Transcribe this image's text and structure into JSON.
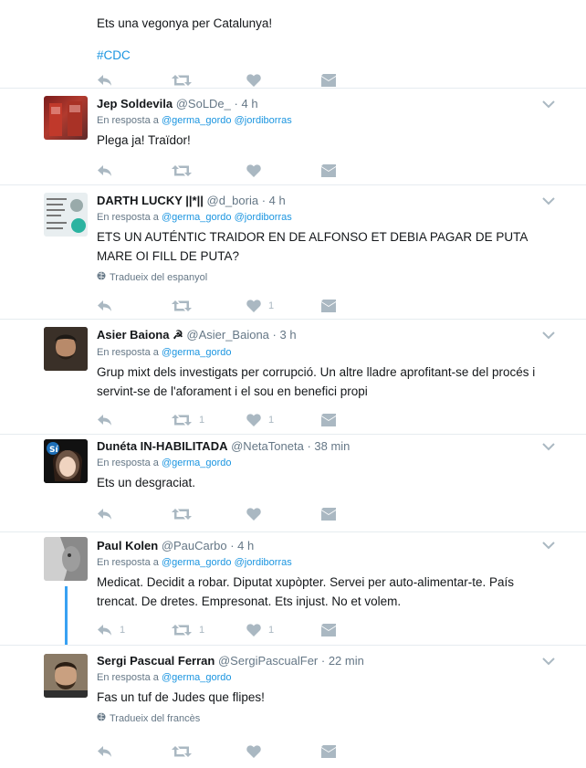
{
  "top_tweet": {
    "lines": [
      "Ets una vegonya per Catalunya!"
    ],
    "hashtag": "#CDC"
  },
  "tweets": [
    {
      "name": "Jep Soldevila",
      "handle": "@SoLDe_",
      "time": "· 4 h",
      "reply_prefix": "En resposta a",
      "reply_to": "@germa_gordo @jordiborras",
      "text": [
        "Plega ja! Traïdor!"
      ],
      "translate": "",
      "reply_count": "",
      "retweet_count": "",
      "like_count": ""
    },
    {
      "name": "DARTH LUCKY ||*||",
      "handle": "@d_boria",
      "time": "· 4 h",
      "reply_prefix": "En resposta a",
      "reply_to": "@germa_gordo @jordiborras",
      "text": [
        "ETS UN AUTÉNTIC TRAIDOR EN DE ALFONSO ET DEBIA PAGAR DE PUTA",
        "MARE OI FILL DE PUTA?"
      ],
      "translate": "Tradueix del espanyol",
      "reply_count": "",
      "retweet_count": "",
      "like_count": "1"
    },
    {
      "name": "Asier Baiona ☭",
      "handle": "@Asier_Baiona",
      "time": "· 3 h",
      "reply_prefix": "En resposta a",
      "reply_to": "@germa_gordo",
      "text": [
        "Grup mixt dels investigats per corrupció. Un altre lladre aprofitant-se del procés i",
        "servint-se de l'aforament i el sou en benefici propi"
      ],
      "translate": "",
      "reply_count": "",
      "retweet_count": "1",
      "like_count": "1"
    },
    {
      "name": "Dunéta IN-HABILITADA",
      "handle": "@NetaToneta",
      "time": "· 38 min",
      "reply_prefix": "En resposta a",
      "reply_to": "@germa_gordo",
      "text": [
        "Ets un desgraciat."
      ],
      "translate": "",
      "reply_count": "",
      "retweet_count": "",
      "like_count": ""
    },
    {
      "name": "Paul Kolen",
      "handle": "@PauCarbo",
      "time": "· 4 h",
      "reply_prefix": "En resposta a",
      "reply_to": "@germa_gordo @jordiborras",
      "text": [
        "Medicat. Decidit a robar. Diputat xupòpter. Servei per auto-alimentar-te. País",
        "trencat. De dretes. Empresonat. Ets injust. No et volem."
      ],
      "translate": "",
      "reply_count": "1",
      "retweet_count": "1",
      "like_count": "1"
    },
    {
      "name": "Sergi Pascual Ferran",
      "handle": "@SergiPascualFer",
      "time": "· 22 min",
      "reply_prefix": "En resposta a",
      "reply_to": "@germa_gordo",
      "text": [
        "Fas un tuf de Judes que flipes!"
      ],
      "translate": "Tradueix del francès",
      "reply_count": "",
      "retweet_count": "",
      "like_count": ""
    }
  ],
  "icons": {
    "reply": "reply-icon",
    "retweet": "retweet-icon",
    "like": "heart-icon",
    "dm": "envelope-icon",
    "caret": "chevron-down-icon",
    "globe": "globe-icon"
  },
  "colors": {
    "link": "#1b95e0",
    "muted": "#657786",
    "icon": "#aab8c2",
    "thread": "#38a1f3"
  }
}
